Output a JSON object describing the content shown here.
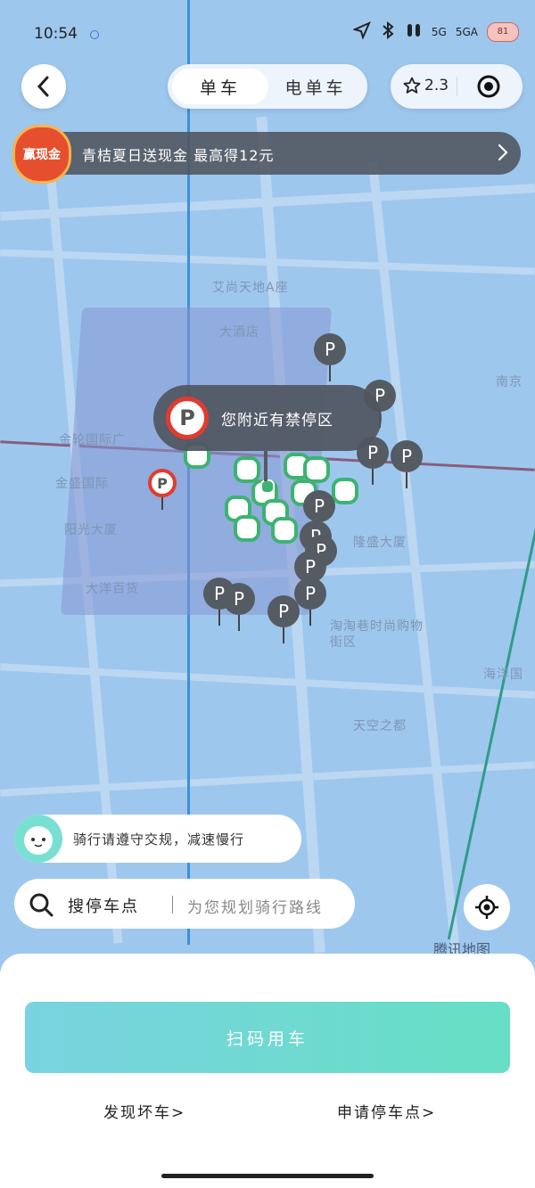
{
  "status_bar": {
    "time": "10:54",
    "battery": "81",
    "signal_labels": [
      "5G",
      "5GA"
    ]
  },
  "header": {
    "tabs": [
      {
        "label": "单车",
        "active": true
      },
      {
        "label": "电单车",
        "active": false
      }
    ],
    "rating": "2.3"
  },
  "promo": {
    "badge": "赢现金",
    "text": "青桔夏日送现金 最高得12元"
  },
  "map": {
    "pois": [
      "艾尚天地A座",
      "大酒店",
      "金轮国际广",
      "金盛国际",
      "阳光大厦",
      "大洋百货",
      "隆盛大厦",
      "淘淘巷时尚购物街区",
      "天空之都",
      "南京",
      "海洋国"
    ],
    "parking_pin_label": "P",
    "no_parking_tip": "您附近有禁停区",
    "watermark": "腾讯地图"
  },
  "tip": {
    "text": "骑行请遵守交规，减速慢行"
  },
  "search": {
    "label": "搜停车点",
    "placeholder": "为您规划骑行路线"
  },
  "bottom_sheet": {
    "scan_button": "扫码用车",
    "report_link": "发现坏车>",
    "apply_link": "申请停车点>"
  },
  "colors": {
    "map_bg": "#9ec7ee",
    "bike_green": "#3cb371",
    "scan_gradient": [
      "#79d3e0",
      "#66dfc4"
    ]
  }
}
